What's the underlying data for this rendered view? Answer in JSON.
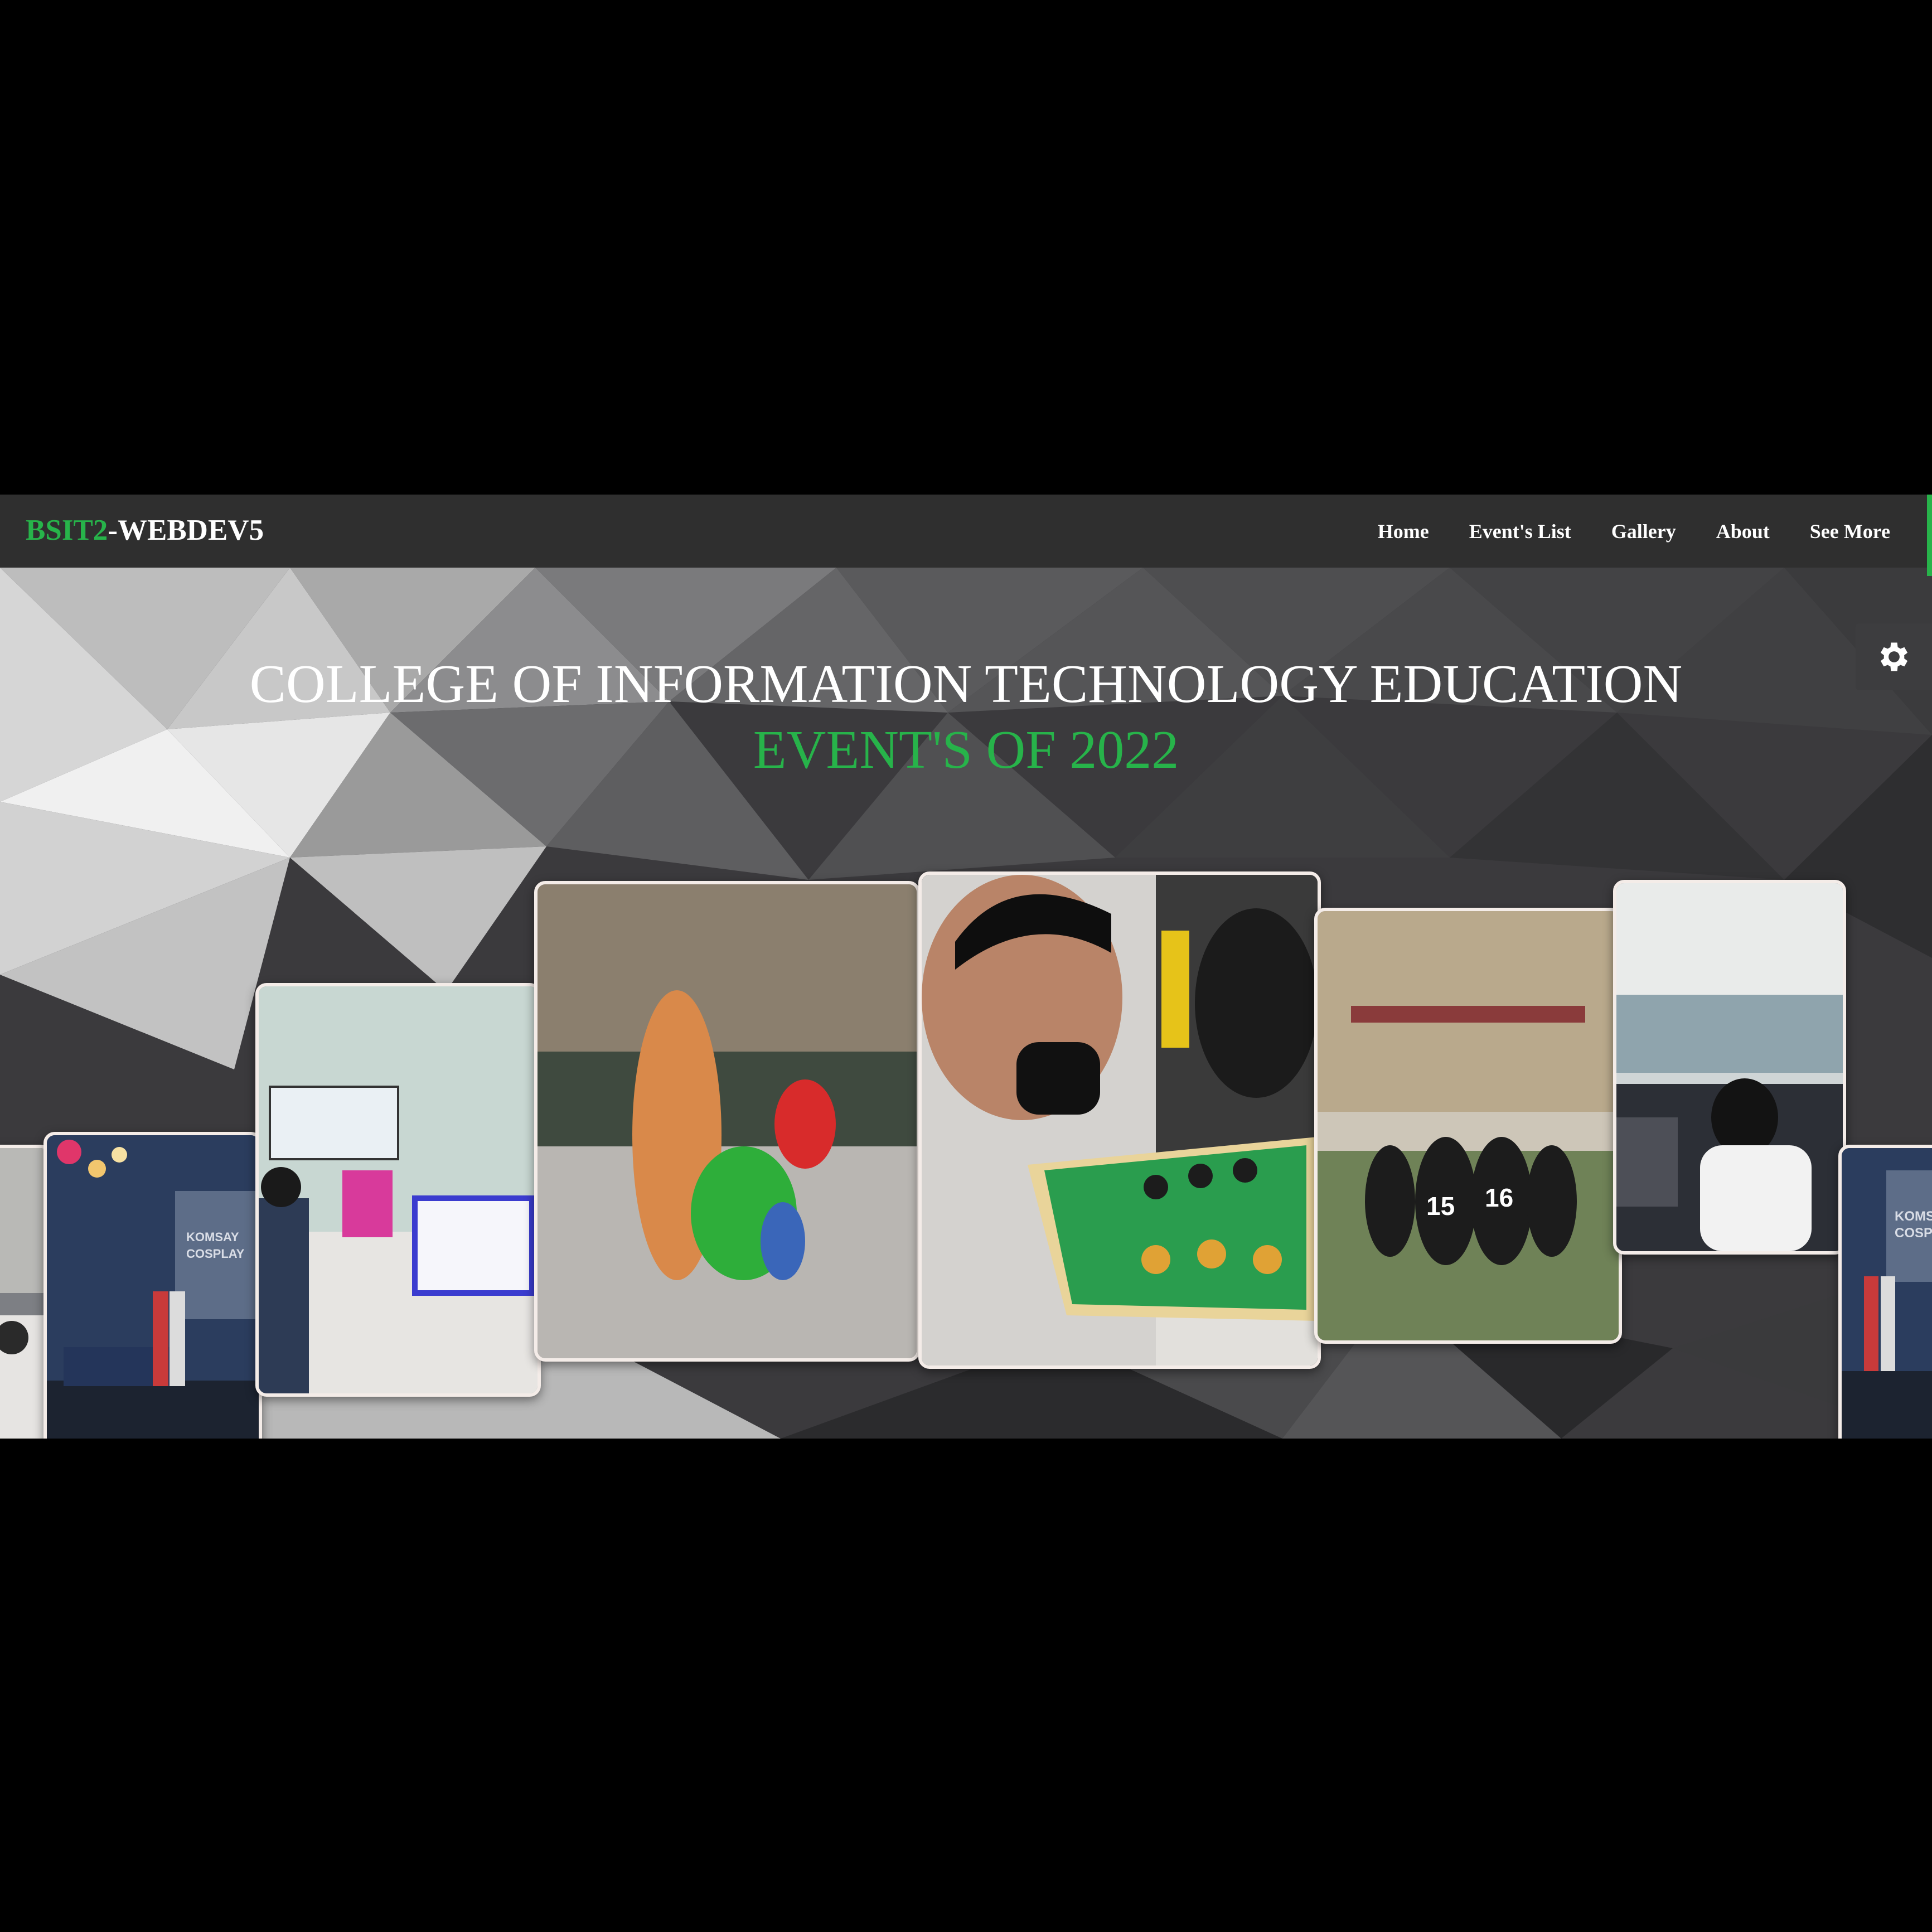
{
  "navbar": {
    "brand_accent": "BSIT2",
    "brand_rest": "-WEBDEV5",
    "links": [
      "Home",
      "Event's List",
      "Gallery",
      "About",
      "See More"
    ]
  },
  "hero": {
    "title_line1": "COLLEGE OF INFORMATION TECHNOLOGY EDUCATION",
    "title_line2": "EVENT'S OF 2022",
    "cards": [
      {
        "subject": "stage event",
        "sign_text": "KOMSAY COSPLAY"
      },
      {
        "subject": "computer lab"
      },
      {
        "subject": "inflatable costumes in gym"
      },
      {
        "subject": "chess match"
      },
      {
        "subject": "volleyball team",
        "jersey_numbers": [
          "15",
          "16"
        ]
      },
      {
        "subject": "students at laptops"
      },
      {
        "subject": "stage event",
        "sign_text": "KOMS COSPL"
      }
    ]
  },
  "icons": {
    "settings": "gear-icon"
  },
  "colors": {
    "accent": "#27b34a",
    "navbar": "#2f2f2f",
    "background": "#000000"
  }
}
